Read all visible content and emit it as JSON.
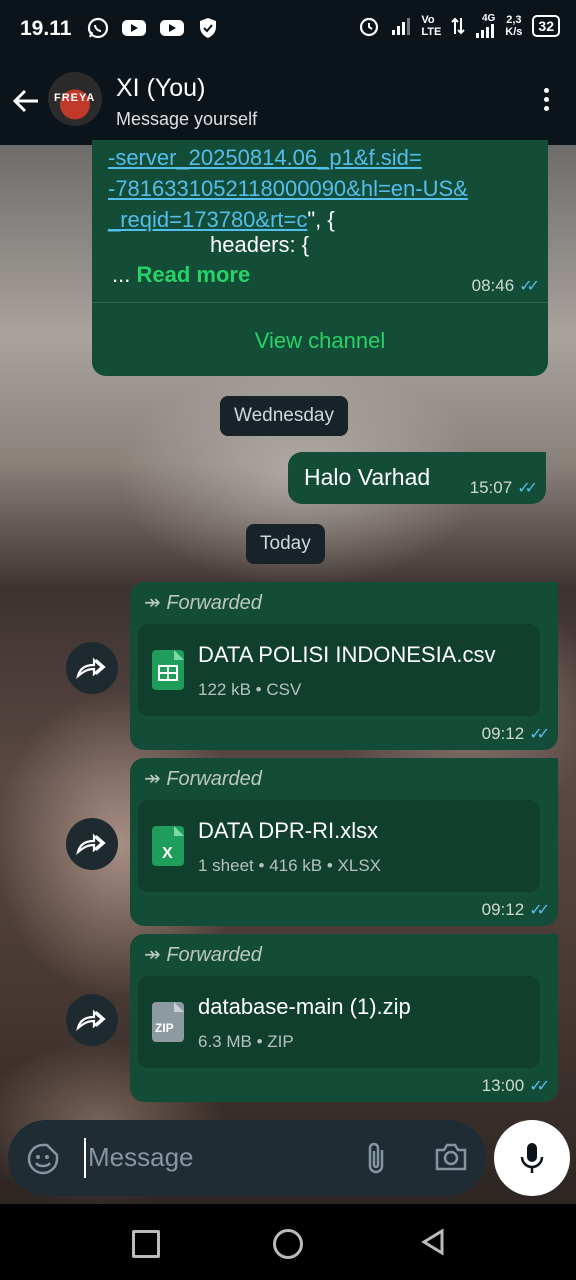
{
  "status": {
    "time": "19.11",
    "net_speed_top": "2,3",
    "net_speed_bottom": "K/s",
    "battery": "32",
    "volte_top": "Vo",
    "volte_bottom": "LTE",
    "gen": "4G"
  },
  "header": {
    "contact_name": "XI (You)",
    "subtitle": "Message yourself",
    "avatar_text": "FREYA"
  },
  "message1": {
    "link_line1": "-server_20250814.06_p1&f.sid=",
    "link_line2": "-7816331052118000090&hl=en-US&",
    "link_line3": "_reqid=173780&rt=c",
    "link_tail": "\", {",
    "headers_line": "headers: {",
    "ellipsis": "...",
    "read_more": "Read more",
    "time": "08:46",
    "view_channel": "View channel"
  },
  "date_wednesday": "Wednesday",
  "message2": {
    "text": "Halo Varhad",
    "time": "15:07"
  },
  "date_today": "Today",
  "forwarded_label": "Forwarded",
  "files": [
    {
      "name": "DATA POLISI INDONESIA.csv",
      "size": "122 kB",
      "type": "CSV",
      "time": "09:12",
      "icon_text": "▦",
      "color": "#1e9e5a"
    },
    {
      "name": "DATA DPR-RI.xlsx",
      "size": "1 sheet",
      "size2": "416 kB",
      "type": "XLSX",
      "time": "09:12",
      "icon_text": "X",
      "color": "#1e9e5a"
    },
    {
      "name": "database-main (1).zip",
      "size": "6.3 MB",
      "type": "ZIP",
      "time": "13:00",
      "icon_text": "ZIP",
      "color": "#8e9aa1"
    }
  ],
  "meta_sep": "•",
  "input": {
    "placeholder": "Message"
  }
}
